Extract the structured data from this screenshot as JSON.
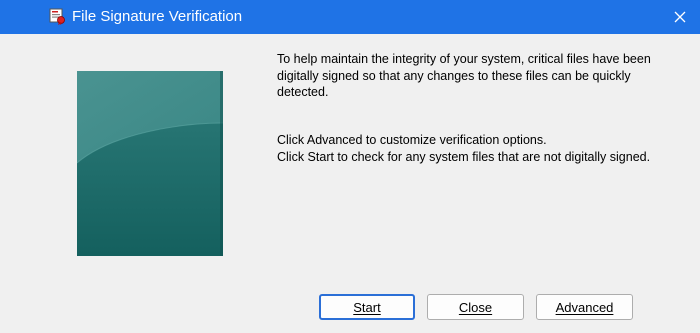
{
  "window": {
    "title": "File Signature Verification",
    "close_icon": "close-icon",
    "app_icon": "file-signature-app-icon",
    "titlebar_color": "#1f73e6"
  },
  "content": {
    "paragraph1": "To help maintain the integrity of your system, critical files have been digitally signed so that any changes to these files can be quickly detected.",
    "paragraph2_line1": "Click Advanced to customize verification options.",
    "paragraph2_line2": "Click Start to check for any system files that are not digitally signed.",
    "banner_color": "#1c6a6a"
  },
  "buttons": {
    "start": "Start",
    "close": "Close",
    "advanced": "Advanced"
  }
}
